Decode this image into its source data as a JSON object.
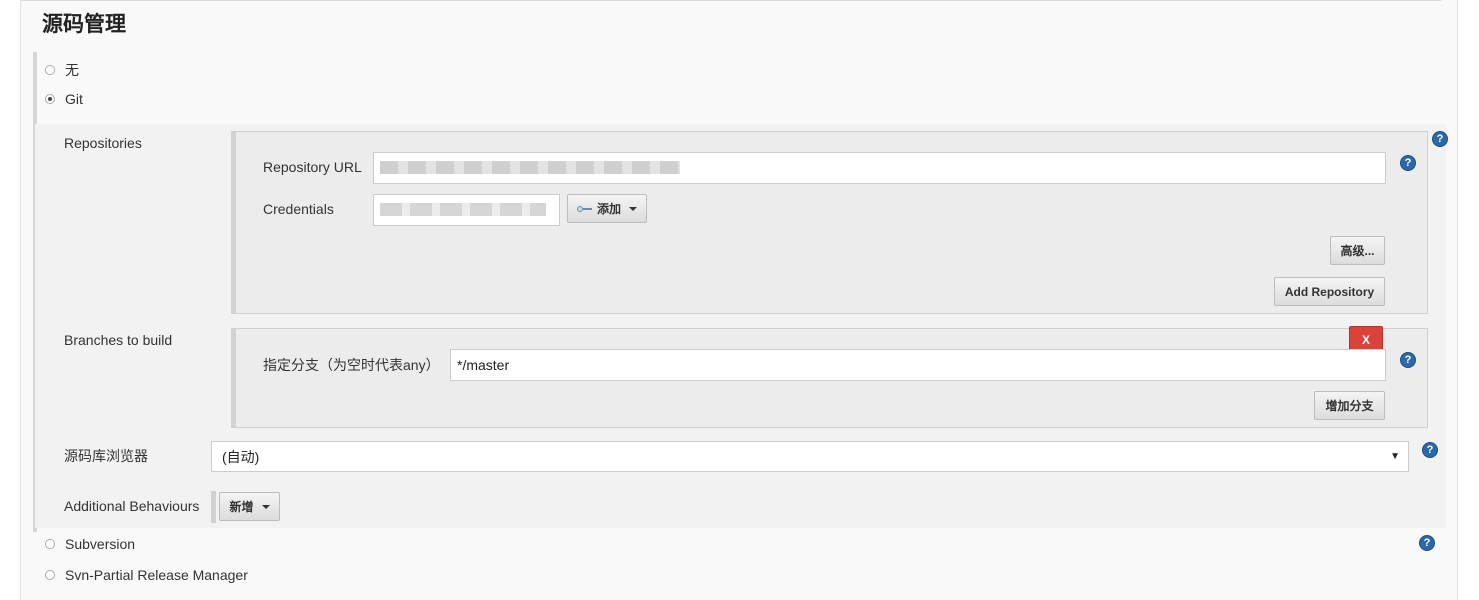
{
  "section": {
    "title": "源码管理"
  },
  "scm_options": [
    {
      "label": "无",
      "checked": false
    },
    {
      "label": "Git",
      "checked": true
    },
    {
      "label": "Subversion",
      "checked": false
    },
    {
      "label": "Svn-Partial Release Manager",
      "checked": false
    }
  ],
  "git": {
    "repositories": {
      "label": "Repositories",
      "url_label": "Repository URL",
      "url_value": "",
      "credentials_label": "Credentials",
      "credentials_value": "",
      "add_button": "添加",
      "advanced_button": "高级...",
      "add_repository_button": "Add Repository"
    },
    "branches": {
      "label": "Branches to build",
      "delete_button": "X",
      "spec_label": "指定分支（为空时代表any）",
      "spec_value": "*/master",
      "add_branch_button": "增加分支"
    },
    "browser": {
      "label": "源码库浏览器",
      "selected": "(自动)"
    },
    "behaviours": {
      "label": "Additional Behaviours",
      "button": "新增"
    }
  },
  "help_icon_text": "?"
}
